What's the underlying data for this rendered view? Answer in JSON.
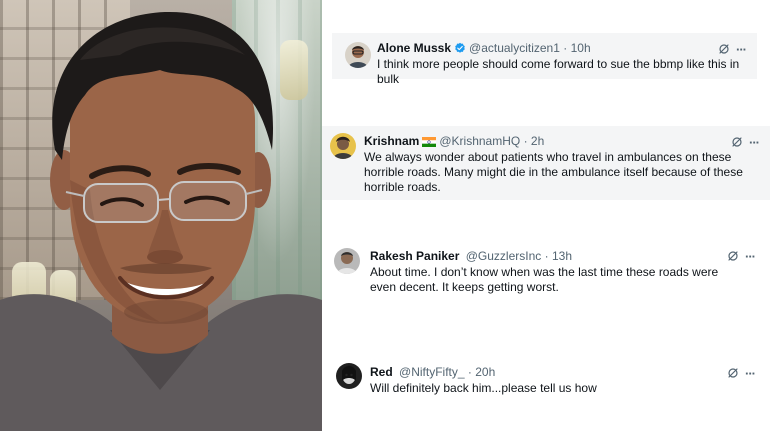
{
  "tweets": [
    {
      "name": "Alone Mussk",
      "handle": "@actualycitizen1",
      "sep": "·",
      "time": "10h",
      "verified": true,
      "flag": "",
      "text": "I think more people should come forward to sue the bbmp like this in bulk"
    },
    {
      "name": "Krishnam",
      "handle": "@KrishnamHQ",
      "sep": "·",
      "time": "2h",
      "verified": false,
      "flag": "india-flag",
      "text": "We always wonder about patients who travel in ambulances on these horrible roads. Many might die in the ambulance itself because of these horrible roads."
    },
    {
      "name": "Rakesh Paniker",
      "handle": "@GuzzlersInc",
      "sep": "·",
      "time": "13h",
      "verified": false,
      "flag": "",
      "text": "About time. I don’t know when was the last time these roads were even decent. It keeps getting worst."
    },
    {
      "name": "Red",
      "handle": "@NiftyFifty_",
      "sep": "·",
      "time": "20h",
      "verified": false,
      "flag": "",
      "text": "Will definitely back him...please tell us how"
    }
  ],
  "actions": {
    "more_label": "···",
    "grok_icon": "grok-icon"
  },
  "colors": {
    "name": "#0f1419",
    "muted": "#536471",
    "verified_blue": "#1d9bf0",
    "card_shade": "#f4f5f6"
  }
}
